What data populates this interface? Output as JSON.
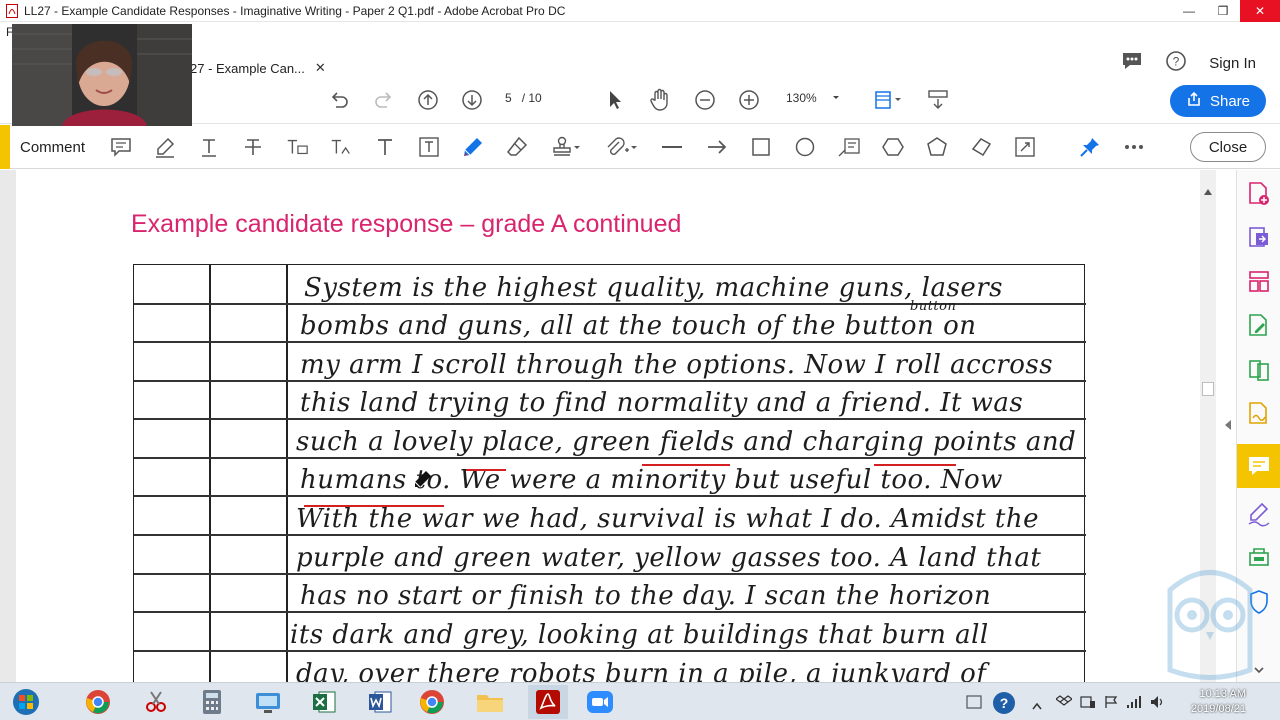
{
  "window": {
    "title": "LL27 - Example Candidate Responses - Imaginative Writing - Paper 2 Q1.pdf - Adobe Acrobat Pro DC",
    "controls": [
      "—",
      "❒",
      "✕"
    ]
  },
  "menu": {
    "first_letter": "F"
  },
  "tab": {
    "label": "27 - Example Can...",
    "close": "✕"
  },
  "header": {
    "sign_in": "Sign In",
    "share_label": "Share"
  },
  "toolbar": {
    "page_current": "5",
    "page_total": "/ 10",
    "zoom": "130%"
  },
  "comment_toolbar": {
    "label": "Comment",
    "close_label": "Close"
  },
  "document": {
    "heading": "Example candidate response – grade A continued",
    "lines": [
      "System is the highest quality, machine guns, lasers",
      "bombs and guns, all at the touch of the button on",
      "my arm I scroll through the options. Now I roll accross",
      "this land trying to find normality and a friend. It was",
      "such a lovely place, green fields and charging points and",
      "humans to. We were a minority but useful too. Now",
      "With the war we had, survival is what I do. Amidst the",
      "purple and green water, yellow gasses too. A land that",
      "has no start or finish to the day. I scan the horizon",
      "its dark and grey, looking at buildings that burn all",
      "day, over there robots burn in a pile, a junkyard of"
    ],
    "insertion_above": "button",
    "struck_word": "button"
  },
  "taskbar": {
    "time": "10:13 AM",
    "date": "2019/08/21"
  },
  "colors": {
    "heading": "#d9246e",
    "accent_yellow": "#f5c400",
    "share_blue": "#1473e6",
    "annotation_red": "#d42020"
  }
}
